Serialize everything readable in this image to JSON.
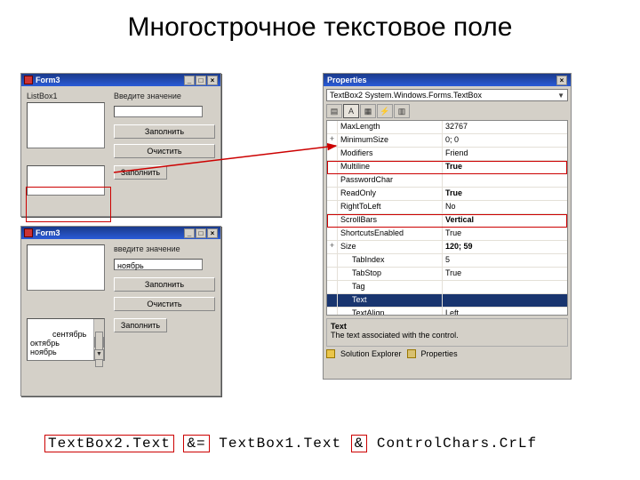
{
  "slide": {
    "title": "Многострочное текстовое поле"
  },
  "form_a": {
    "title": "Form3",
    "listLabel": "ListBox1",
    "prompt": "Введите значение",
    "btn_fill": "Заполнить",
    "btn_clear": "Очистить",
    "btn_add": "Заполнить"
  },
  "form_b": {
    "title": "Form3",
    "prompt": "введите значение",
    "input_value": "ноябрь",
    "btn_fill": "Заполнить",
    "btn_clear": "Очистить",
    "btn_add": "Заполнить",
    "multiline_text": "сентябрь\nоктябрь\nноябрь"
  },
  "properties": {
    "panel_title": "Properties",
    "combo": "TextBox2  System.Windows.Forms.TextBox",
    "rows": [
      {
        "exp": "",
        "name": "MaxLength",
        "val": "32767",
        "bold": false
      },
      {
        "exp": "+",
        "name": "MinimumSize",
        "val": "0; 0",
        "bold": false
      },
      {
        "exp": "",
        "name": "Modifiers",
        "val": "Friend",
        "bold": false
      },
      {
        "exp": "",
        "name": "Multiline",
        "val": "True",
        "bold": true,
        "hl": true
      },
      {
        "exp": "",
        "name": "PasswordChar",
        "val": "",
        "bold": false
      },
      {
        "exp": "",
        "name": "ReadOnly",
        "val": "True",
        "bold": true
      },
      {
        "exp": "",
        "name": "RightToLeft",
        "val": "No",
        "bold": false
      },
      {
        "exp": "",
        "name": "ScrollBars",
        "val": "Vertical",
        "bold": true,
        "hl": true
      },
      {
        "exp": "",
        "name": "ShortcutsEnabled",
        "val": "True",
        "bold": false
      },
      {
        "exp": "+",
        "name": "Size",
        "val": "120; 59",
        "bold": true
      },
      {
        "exp": "",
        "name": "TabIndex",
        "val": "5",
        "bold": false,
        "indent": true
      },
      {
        "exp": "",
        "name": "TabStop",
        "val": "True",
        "bold": false,
        "indent": true
      },
      {
        "exp": "",
        "name": "Tag",
        "val": "",
        "bold": false,
        "indent": true
      },
      {
        "exp": "",
        "name": "Text",
        "val": "",
        "bold": false,
        "sel": true,
        "indent": true
      },
      {
        "exp": "",
        "name": "TextAlign",
        "val": "Left",
        "bold": false,
        "indent": true
      }
    ],
    "desc_name": "Text",
    "desc_text": "The text associated with the control.",
    "tab_sol": "Solution Explorer",
    "tab_prop": "Properties"
  },
  "code": {
    "p1": "TextBox2.Text",
    "op1": "&=",
    "p2": "TextBox1.Text",
    "op2": "&",
    "p3": "ControlChars.CrLf"
  }
}
